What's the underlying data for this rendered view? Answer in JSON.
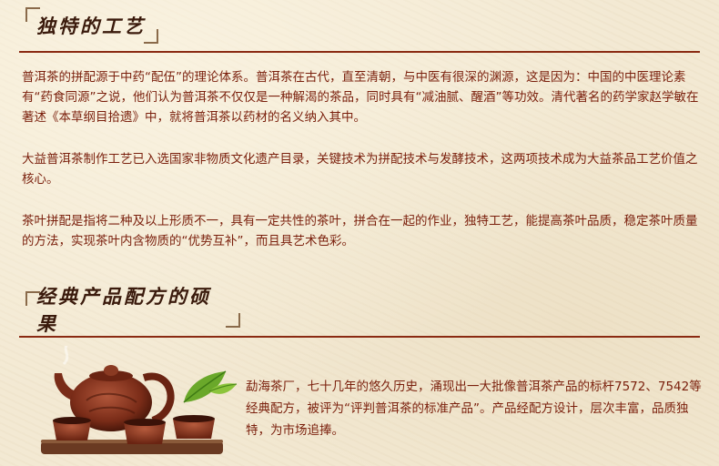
{
  "section1": {
    "title": "独特的工艺",
    "paragraphs": [
      "普洱茶的拼配源于中药“配伍”的理论体系。普洱茶在古代，直至清朝，与中医有很深的渊源，这是因为：中国的中医理论素有“药食同源”之说，他们认为普洱茶不仅仅是一种解渴的茶品，同时具有“减油腻、醒酒”等功效。清代著名的药学家赵学敏在著述《本草纲目拾遗》中，就将普洱茶以药材的名义纳入其中。",
      "大益普洱茶制作工艺已入选国家非物质文化遗产目录，关键技术为拼配技术与发酵技术，这两项技术成为大益茶品工艺价值之核心。",
      "茶叶拼配是指将二种及以上形质不一，具有一定共性的茶叶，拼合在一起的作业，独特工艺，能提高茶叶品质，稳定茶叶质量的方法，实现茶叶内含物质的“优势互补”，而且具艺术色彩。"
    ]
  },
  "section2": {
    "title": "经典产品配方的硕果",
    "text": "勐海茶厂，七十几年的悠久历史，涌现出一大批像普洱茶产品的标杆7572、7542等经典配方，被评为“评判普洱茶的标准产品”。产品经配方设计，层次丰富，品质独特，为市场追捧。"
  },
  "colors": {
    "text": "#7a1f0c",
    "rule": "#8a2a12",
    "background": "#f3e9d3"
  },
  "icons": [
    "teapot-illustration",
    "tea-leaf-icon"
  ]
}
